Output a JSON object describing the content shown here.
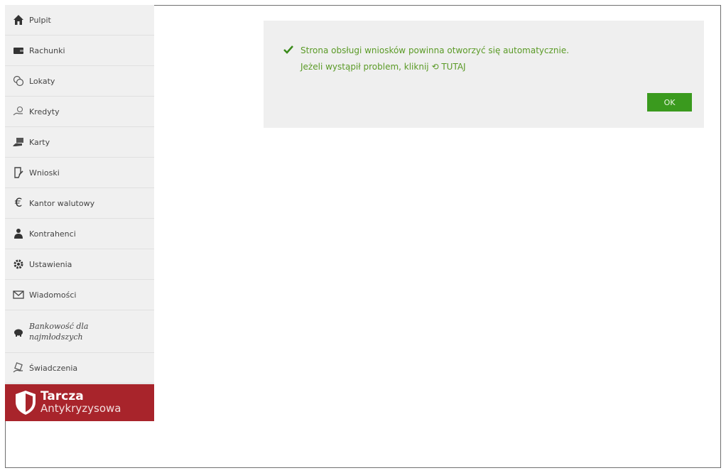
{
  "sidebar": {
    "items": [
      {
        "label": "Pulpit",
        "icon": "home-icon"
      },
      {
        "label": "Rachunki",
        "icon": "wallet-icon"
      },
      {
        "label": "Lokaty",
        "icon": "coins-icon"
      },
      {
        "label": "Kredyty",
        "icon": "hand-coins-icon"
      },
      {
        "label": "Karty",
        "icon": "card-hand-icon"
      },
      {
        "label": "Wnioski",
        "icon": "document-icon"
      },
      {
        "label": "Kantor walutowy",
        "icon": "euro-icon"
      },
      {
        "label": "Kontrahenci",
        "icon": "person-icon"
      },
      {
        "label": "Ustawienia",
        "icon": "gear-icon"
      },
      {
        "label": "Wiadomości",
        "icon": "envelope-icon"
      },
      {
        "label_line1": "Bankowość dla",
        "label_line2": "najmłodszych",
        "icon": "piggy-bank-icon"
      },
      {
        "label": "Świadczenia",
        "icon": "benefits-icon"
      }
    ],
    "banner": {
      "line1": "Tarcza",
      "line2": "Antykryzysowa",
      "icon": "shield-icon",
      "color": "#a8242b"
    }
  },
  "notice": {
    "line1": "Strona obsługi wniosków powinna otworzyć się automatycznie.",
    "line2_prefix": "Jeżeli wystąpił problem, kliknij",
    "link_label": "TUTAJ",
    "ok_label": "OK",
    "text_color": "#5a9a26",
    "button_color": "#3a9a1e"
  }
}
